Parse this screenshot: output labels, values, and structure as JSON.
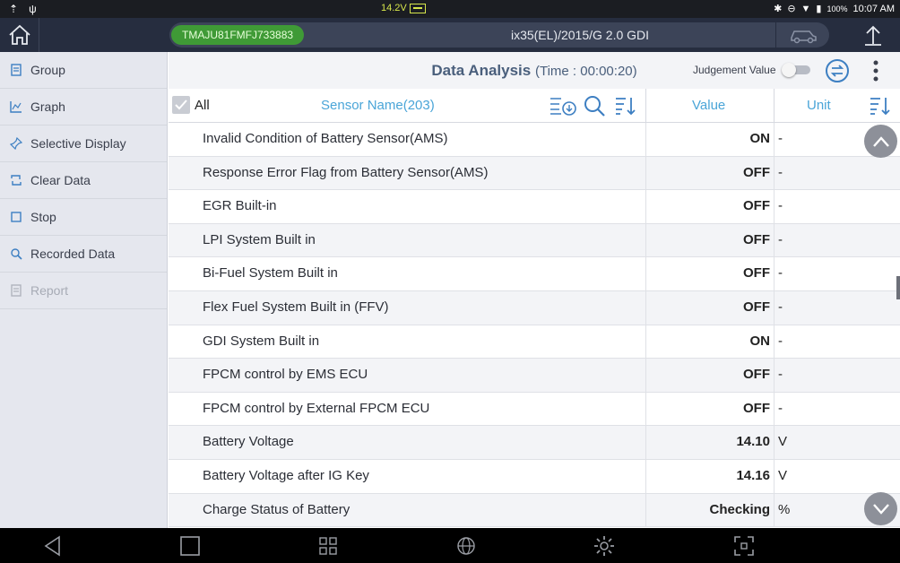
{
  "status_bar": {
    "voltage": "14.2V",
    "battery_pct": "100%",
    "time": "10:07 AM"
  },
  "header": {
    "vin": "TMAJU81FMFJ733883",
    "vehicle": "ix35(EL)/2015/G 2.0 GDI"
  },
  "sidebar": {
    "items": [
      {
        "label": "Group",
        "icon": "group-icon"
      },
      {
        "label": "Graph",
        "icon": "graph-icon"
      },
      {
        "label": "Selective Display",
        "icon": "pin-icon"
      },
      {
        "label": "Clear Data",
        "icon": "refresh-icon"
      },
      {
        "label": "Stop",
        "icon": "stop-icon"
      },
      {
        "label": "Recorded Data",
        "icon": "search-record-icon"
      },
      {
        "label": "Report",
        "icon": "report-icon"
      }
    ]
  },
  "main": {
    "title": "Data Analysis",
    "time_label": "(Time : 00:00:20)",
    "judgement_label": "Judgement Value"
  },
  "table": {
    "all_label": "All",
    "sensor_header": "Sensor Name(203)",
    "value_header": "Value",
    "unit_header": "Unit",
    "rows": [
      {
        "name": "Invalid Condition of Battery Sensor(AMS)",
        "value": "ON",
        "unit": "-"
      },
      {
        "name": "Response Error Flag from Battery Sensor(AMS)",
        "value": "OFF",
        "unit": "-"
      },
      {
        "name": "EGR Built-in",
        "value": "OFF",
        "unit": "-"
      },
      {
        "name": "LPI System Built in",
        "value": "OFF",
        "unit": "-"
      },
      {
        "name": "Bi-Fuel System Built in",
        "value": "OFF",
        "unit": "-"
      },
      {
        "name": "Flex Fuel System Built in (FFV)",
        "value": "OFF",
        "unit": "-"
      },
      {
        "name": "GDI System Built in",
        "value": "ON",
        "unit": "-"
      },
      {
        "name": "FPCM control by EMS ECU",
        "value": "OFF",
        "unit": "-"
      },
      {
        "name": "FPCM control by External FPCM ECU",
        "value": "OFF",
        "unit": "-"
      },
      {
        "name": "Battery Voltage",
        "value": "14.10",
        "unit": "V"
      },
      {
        "name": "Battery Voltage after IG Key",
        "value": "14.16",
        "unit": "V"
      },
      {
        "name": "Charge Status of Battery",
        "value": "Checking",
        "unit": "%"
      }
    ]
  }
}
